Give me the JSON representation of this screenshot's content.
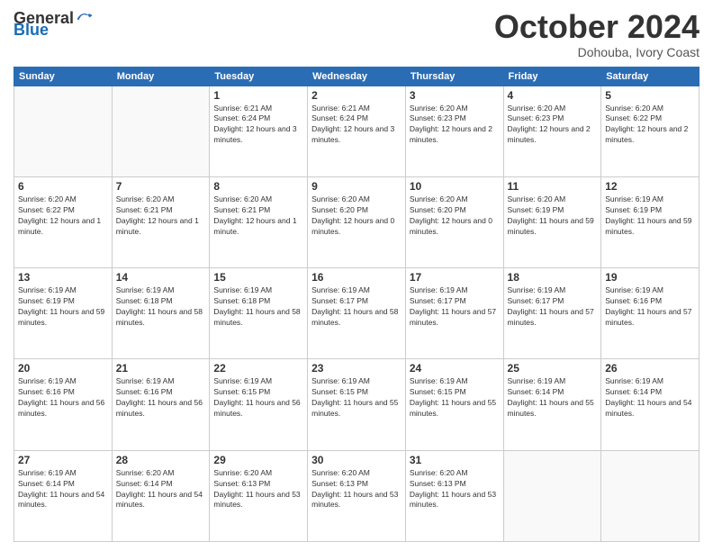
{
  "logo": {
    "general": "General",
    "blue": "Blue"
  },
  "header": {
    "month": "October 2024",
    "location": "Dohouba, Ivory Coast"
  },
  "weekdays": [
    "Sunday",
    "Monday",
    "Tuesday",
    "Wednesday",
    "Thursday",
    "Friday",
    "Saturday"
  ],
  "weeks": [
    [
      {
        "day": "",
        "info": ""
      },
      {
        "day": "",
        "info": ""
      },
      {
        "day": "1",
        "info": "Sunrise: 6:21 AM\nSunset: 6:24 PM\nDaylight: 12 hours and 3 minutes."
      },
      {
        "day": "2",
        "info": "Sunrise: 6:21 AM\nSunset: 6:24 PM\nDaylight: 12 hours and 3 minutes."
      },
      {
        "day": "3",
        "info": "Sunrise: 6:20 AM\nSunset: 6:23 PM\nDaylight: 12 hours and 2 minutes."
      },
      {
        "day": "4",
        "info": "Sunrise: 6:20 AM\nSunset: 6:23 PM\nDaylight: 12 hours and 2 minutes."
      },
      {
        "day": "5",
        "info": "Sunrise: 6:20 AM\nSunset: 6:22 PM\nDaylight: 12 hours and 2 minutes."
      }
    ],
    [
      {
        "day": "6",
        "info": "Sunrise: 6:20 AM\nSunset: 6:22 PM\nDaylight: 12 hours and 1 minute."
      },
      {
        "day": "7",
        "info": "Sunrise: 6:20 AM\nSunset: 6:21 PM\nDaylight: 12 hours and 1 minute."
      },
      {
        "day": "8",
        "info": "Sunrise: 6:20 AM\nSunset: 6:21 PM\nDaylight: 12 hours and 1 minute."
      },
      {
        "day": "9",
        "info": "Sunrise: 6:20 AM\nSunset: 6:20 PM\nDaylight: 12 hours and 0 minutes."
      },
      {
        "day": "10",
        "info": "Sunrise: 6:20 AM\nSunset: 6:20 PM\nDaylight: 12 hours and 0 minutes."
      },
      {
        "day": "11",
        "info": "Sunrise: 6:20 AM\nSunset: 6:19 PM\nDaylight: 11 hours and 59 minutes."
      },
      {
        "day": "12",
        "info": "Sunrise: 6:19 AM\nSunset: 6:19 PM\nDaylight: 11 hours and 59 minutes."
      }
    ],
    [
      {
        "day": "13",
        "info": "Sunrise: 6:19 AM\nSunset: 6:19 PM\nDaylight: 11 hours and 59 minutes."
      },
      {
        "day": "14",
        "info": "Sunrise: 6:19 AM\nSunset: 6:18 PM\nDaylight: 11 hours and 58 minutes."
      },
      {
        "day": "15",
        "info": "Sunrise: 6:19 AM\nSunset: 6:18 PM\nDaylight: 11 hours and 58 minutes."
      },
      {
        "day": "16",
        "info": "Sunrise: 6:19 AM\nSunset: 6:17 PM\nDaylight: 11 hours and 58 minutes."
      },
      {
        "day": "17",
        "info": "Sunrise: 6:19 AM\nSunset: 6:17 PM\nDaylight: 11 hours and 57 minutes."
      },
      {
        "day": "18",
        "info": "Sunrise: 6:19 AM\nSunset: 6:17 PM\nDaylight: 11 hours and 57 minutes."
      },
      {
        "day": "19",
        "info": "Sunrise: 6:19 AM\nSunset: 6:16 PM\nDaylight: 11 hours and 57 minutes."
      }
    ],
    [
      {
        "day": "20",
        "info": "Sunrise: 6:19 AM\nSunset: 6:16 PM\nDaylight: 11 hours and 56 minutes."
      },
      {
        "day": "21",
        "info": "Sunrise: 6:19 AM\nSunset: 6:16 PM\nDaylight: 11 hours and 56 minutes."
      },
      {
        "day": "22",
        "info": "Sunrise: 6:19 AM\nSunset: 6:15 PM\nDaylight: 11 hours and 56 minutes."
      },
      {
        "day": "23",
        "info": "Sunrise: 6:19 AM\nSunset: 6:15 PM\nDaylight: 11 hours and 55 minutes."
      },
      {
        "day": "24",
        "info": "Sunrise: 6:19 AM\nSunset: 6:15 PM\nDaylight: 11 hours and 55 minutes."
      },
      {
        "day": "25",
        "info": "Sunrise: 6:19 AM\nSunset: 6:14 PM\nDaylight: 11 hours and 55 minutes."
      },
      {
        "day": "26",
        "info": "Sunrise: 6:19 AM\nSunset: 6:14 PM\nDaylight: 11 hours and 54 minutes."
      }
    ],
    [
      {
        "day": "27",
        "info": "Sunrise: 6:19 AM\nSunset: 6:14 PM\nDaylight: 11 hours and 54 minutes."
      },
      {
        "day": "28",
        "info": "Sunrise: 6:20 AM\nSunset: 6:14 PM\nDaylight: 11 hours and 54 minutes."
      },
      {
        "day": "29",
        "info": "Sunrise: 6:20 AM\nSunset: 6:13 PM\nDaylight: 11 hours and 53 minutes."
      },
      {
        "day": "30",
        "info": "Sunrise: 6:20 AM\nSunset: 6:13 PM\nDaylight: 11 hours and 53 minutes."
      },
      {
        "day": "31",
        "info": "Sunrise: 6:20 AM\nSunset: 6:13 PM\nDaylight: 11 hours and 53 minutes."
      },
      {
        "day": "",
        "info": ""
      },
      {
        "day": "",
        "info": ""
      }
    ]
  ]
}
